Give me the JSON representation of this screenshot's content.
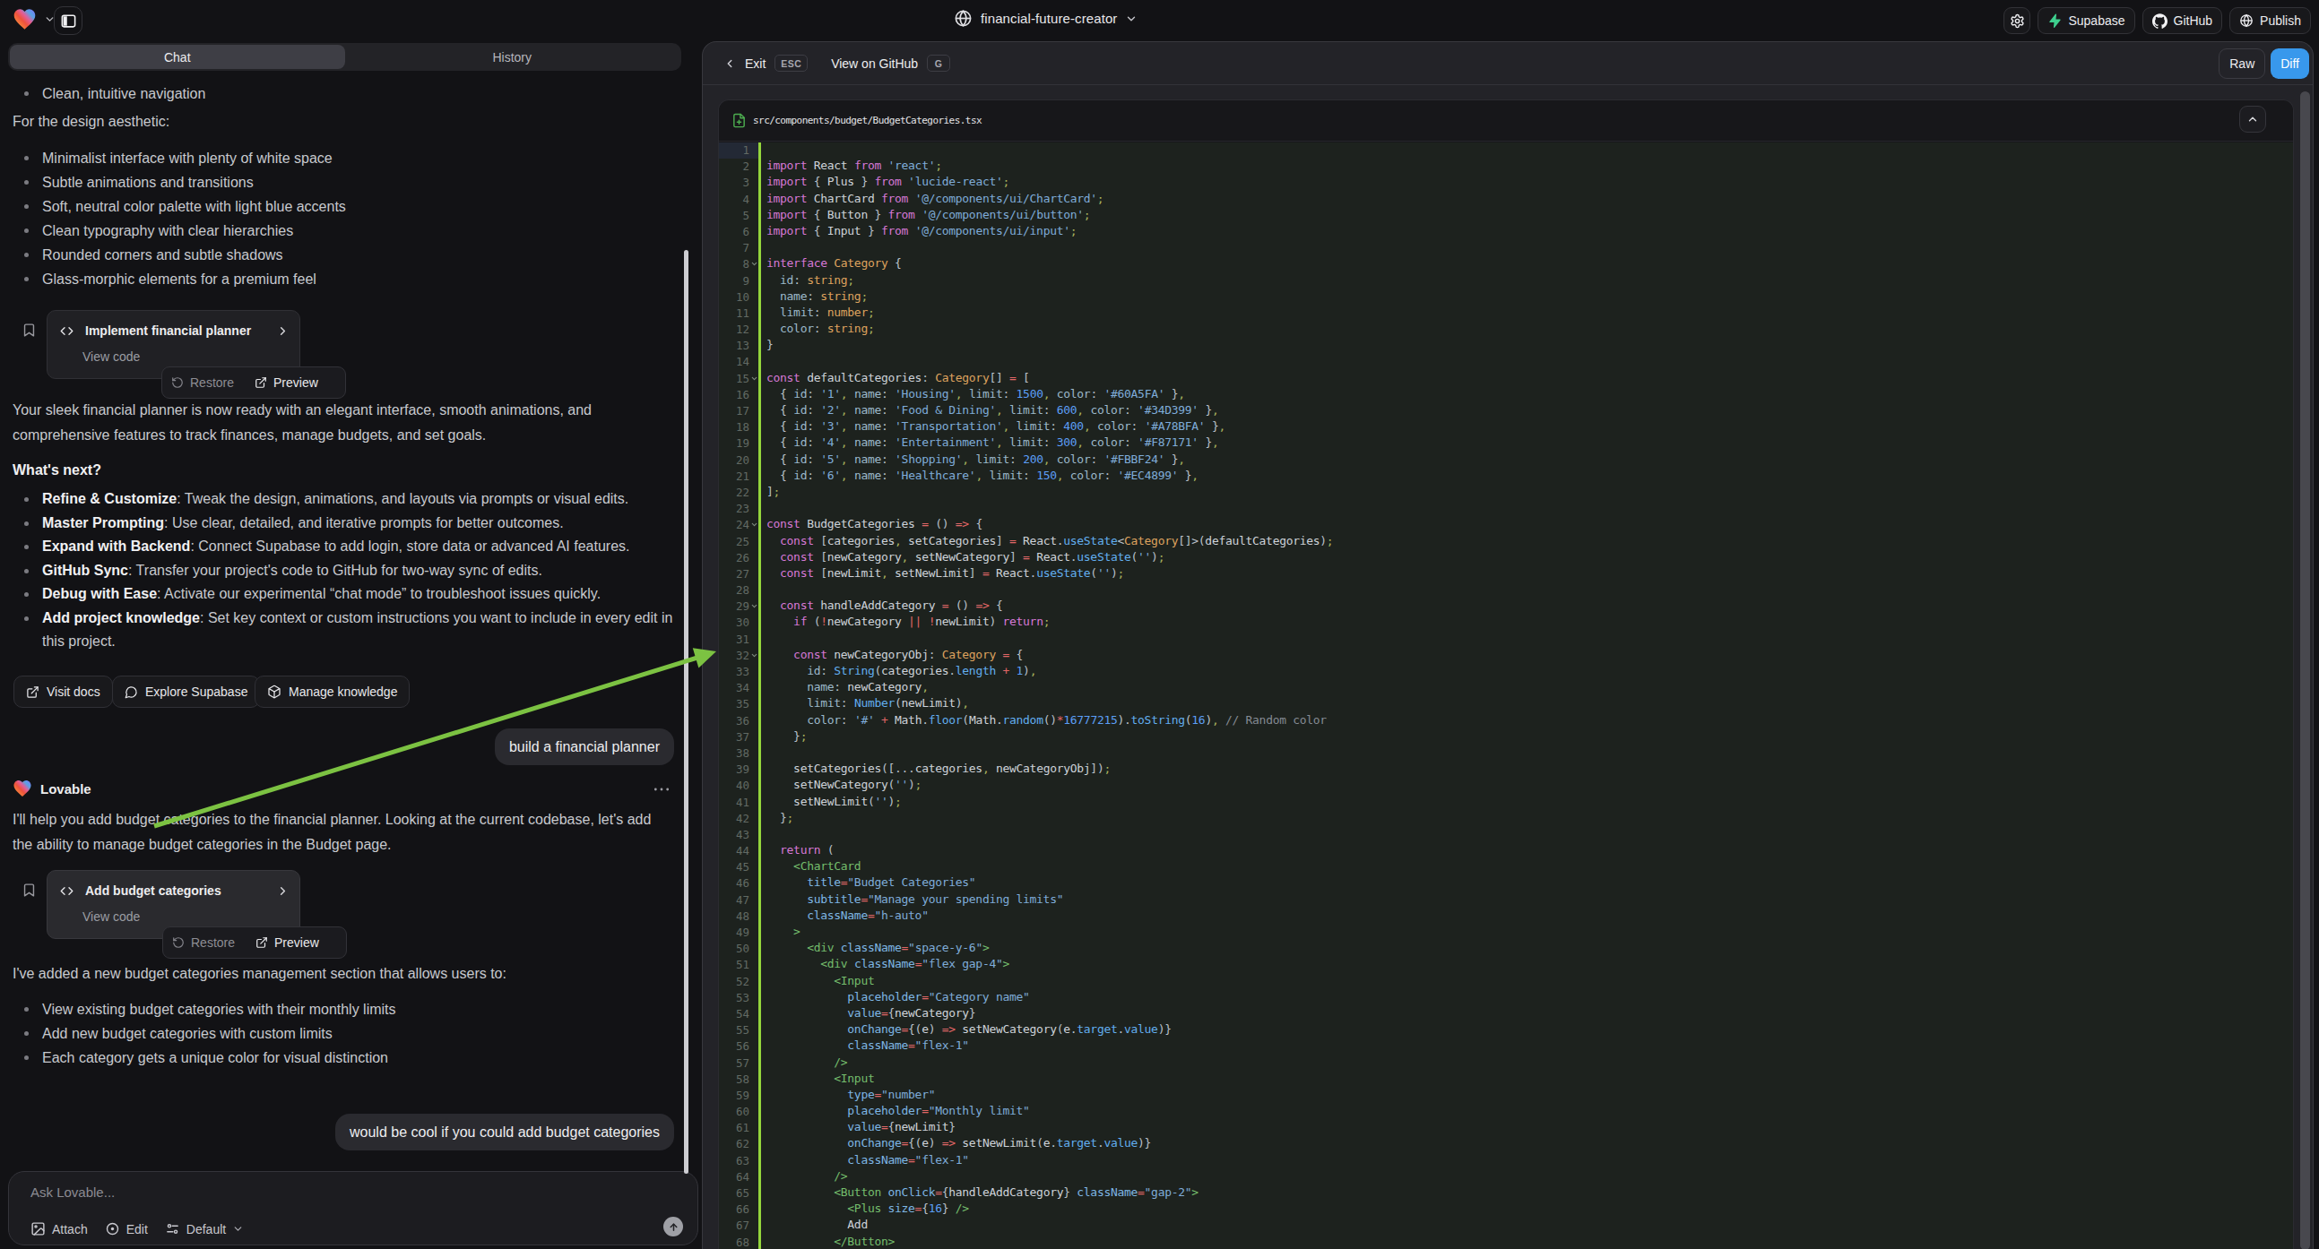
{
  "topbar": {
    "project_name": "financial-future-creator",
    "supabase_label": "Supabase",
    "github_label": "GitHub",
    "publish_label": "Publish"
  },
  "tabs": {
    "chat": "Chat",
    "history": "History"
  },
  "chat": {
    "leading_bullet": "Clean, intuitive navigation",
    "design_intro": "For the design aesthetic:",
    "design_bullets": [
      "Minimalist interface with plenty of white space",
      "Subtle animations and transitions",
      "Soft, neutral color palette with light blue accents",
      "Clean typography with clear hierarchies",
      "Rounded corners and subtle shadows",
      "Glass-morphic elements for a premium feel"
    ],
    "card1": {
      "title": "Implement financial planner",
      "subtitle": "View code",
      "restore": "Restore",
      "preview": "Preview"
    },
    "ready_paragraph_lines": [
      "Your sleek financial planner is now ready with an elegant interface, smooth animations, and",
      "comprehensive features to track finances, manage budgets, and set goals."
    ],
    "next_heading": "What's next?",
    "next_steps": [
      {
        "bold": "Refine & Customize",
        "text": ": Tweak the design, animations, and layouts via prompts or visual edits."
      },
      {
        "bold": "Master Prompting",
        "text": ": Use clear, detailed, and iterative prompts for better outcomes."
      },
      {
        "bold": "Expand with Backend",
        "text": ": Connect Supabase to add login, store data or advanced AI features."
      },
      {
        "bold": "GitHub Sync",
        "text": ": Transfer your project's code to GitHub for two-way sync of edits."
      },
      {
        "bold": "Debug with Ease",
        "text": ": Activate our experimental “chat mode” to troubleshoot issues quickly."
      },
      {
        "bold": "Add project knowledge",
        "text": ": Set key context or custom instructions you want to include in every edit in",
        "text2": "this project."
      }
    ],
    "actions": {
      "visit_docs": "Visit docs",
      "explore_supabase": "Explore Supabase",
      "manage_knowledge": "Manage knowledge"
    },
    "user_bubble_1": "build a financial planner",
    "assistant_name": "Lovable",
    "help_paragraph_lines": [
      "I'll help you add budget categories to the financial planner. Looking at the current codebase, let's add",
      "the ability to manage budget categories in the Budget page."
    ],
    "card2": {
      "title": "Add budget categories",
      "subtitle": "View code",
      "restore": "Restore",
      "preview": "Preview"
    },
    "added_intro": "I've added a new budget categories management section that allows users to:",
    "added_bullets": [
      "View existing budget categories with their monthly limits",
      "Add new budget categories with custom limits",
      "Each category gets a unique color for visual distinction"
    ],
    "user_bubble_2": "would be cool if you could add budget categories",
    "input": {
      "placeholder": "Ask Lovable...",
      "attach": "Attach",
      "edit": "Edit",
      "mode": "Default"
    }
  },
  "codepanel": {
    "exit": "Exit",
    "exit_kbd": "ESC",
    "view_on_github": "View on GitHub",
    "github_kbd": "G",
    "raw": "Raw",
    "diff": "Diff",
    "file_path": "src/components/budget/BudgetCategories.tsx",
    "fold_lines": [
      8,
      15,
      24,
      29,
      32
    ],
    "lines": [
      "",
      "import React from 'react';",
      "import { Plus } from 'lucide-react';",
      "import ChartCard from '@/components/ui/ChartCard';",
      "import { Button } from '@/components/ui/button';",
      "import { Input } from '@/components/ui/input';",
      "",
      "interface Category {",
      "  id: string;",
      "  name: string;",
      "  limit: number;",
      "  color: string;",
      "}",
      "",
      "const defaultCategories: Category[] = [",
      "  { id: '1', name: 'Housing', limit: 1500, color: '#60A5FA' },",
      "  { id: '2', name: 'Food & Dining', limit: 600, color: '#34D399' },",
      "  { id: '3', name: 'Transportation', limit: 400, color: '#A78BFA' },",
      "  { id: '4', name: 'Entertainment', limit: 300, color: '#F87171' },",
      "  { id: '5', name: 'Shopping', limit: 200, color: '#FBBF24' },",
      "  { id: '6', name: 'Healthcare', limit: 150, color: '#EC4899' },",
      "];",
      "",
      "const BudgetCategories = () => {",
      "  const [categories, setCategories] = React.useState<Category[]>(defaultCategories);",
      "  const [newCategory, setNewCategory] = React.useState('');",
      "  const [newLimit, setNewLimit] = React.useState('');",
      "",
      "  const handleAddCategory = () => {",
      "    if (!newCategory || !newLimit) return;",
      "",
      "    const newCategoryObj: Category = {",
      "      id: String(categories.length + 1),",
      "      name: newCategory,",
      "      limit: Number(newLimit),",
      "      color: '#' + Math.floor(Math.random()*16777215).toString(16), // Random color",
      "    };",
      "",
      "    setCategories([...categories, newCategoryObj]);",
      "    setNewCategory('');",
      "    setNewLimit('');",
      "  };",
      "",
      "  return (",
      "    <ChartCard",
      "      title=\"Budget Categories\"",
      "      subtitle=\"Manage your spending limits\"",
      "      className=\"h-auto\"",
      "    >",
      "      <div className=\"space-y-6\">",
      "        <div className=\"flex gap-4\">",
      "          <Input",
      "            placeholder=\"Category name\"",
      "            value={newCategory}",
      "            onChange={(e) => setNewCategory(e.target.value)}",
      "            className=\"flex-1\"",
      "          />",
      "          <Input",
      "            type=\"number\"",
      "            placeholder=\"Monthly limit\"",
      "            value={newLimit}",
      "            onChange={(e) => setNewLimit(e.target.value)}",
      "            className=\"flex-1\"",
      "          />",
      "          <Button onClick={handleAddCategory} className=\"gap-2\">",
      "            <Plus size={16} />",
      "            Add",
      "          </Button>"
    ]
  },
  "colors": {
    "accent_blue": "#3898EC",
    "diff_gutter_green": "#94D63C",
    "arrow_green": "#7CC242",
    "supabase_green": "#3ECF8E",
    "file_icon_green": "#4DAE50"
  }
}
